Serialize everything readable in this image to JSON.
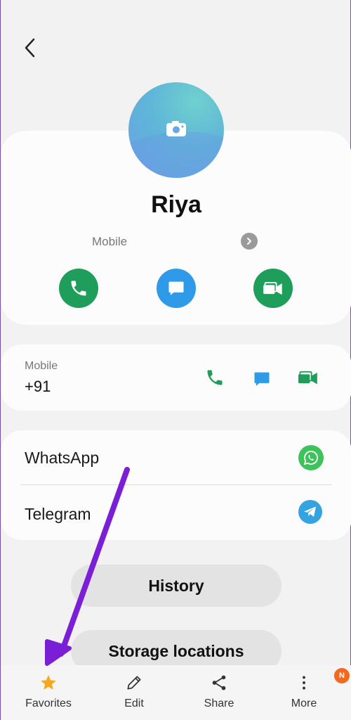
{
  "contact": {
    "name": "Riya",
    "primary_label": "Mobile"
  },
  "phone": {
    "type": "Mobile",
    "number": "+91"
  },
  "apps": [
    {
      "label": "WhatsApp",
      "icon": "whatsapp-icon",
      "color": "#3ec35a"
    },
    {
      "label": "Telegram",
      "icon": "telegram-icon",
      "color": "#35a3df"
    }
  ],
  "buttons": {
    "history": "History",
    "storage": "Storage locations"
  },
  "bottom_nav": [
    {
      "label": "Favorites",
      "icon": "star-icon"
    },
    {
      "label": "Edit",
      "icon": "pencil-icon"
    },
    {
      "label": "Share",
      "icon": "share-icon"
    },
    {
      "label": "More",
      "icon": "more-icon",
      "badge": "N"
    }
  ],
  "colors": {
    "call_green": "#1f9d5a",
    "message_blue": "#2f9be8",
    "star_orange": "#f5a623",
    "badge_orange": "#f26a21",
    "annotation_purple": "#7a1fd6"
  }
}
